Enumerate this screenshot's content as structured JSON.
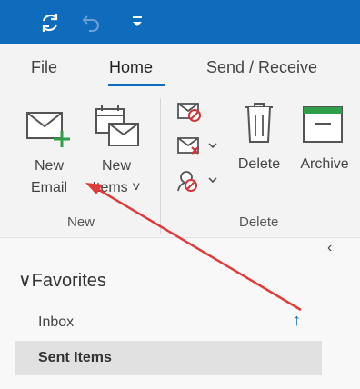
{
  "ribbon_tabs": {
    "file": "File",
    "home": "Home",
    "send_receive": "Send / Receive"
  },
  "new_group": {
    "new_email": {
      "line1": "New",
      "line2": "Email"
    },
    "new_items": {
      "line1": "New",
      "line2": "Items ˅"
    },
    "label": "New"
  },
  "delete_group": {
    "delete": "Delete",
    "archive": "Archive",
    "label": "Delete"
  },
  "nav": {
    "collapse_glyph": "‹",
    "favorites_header": "∨Favorites",
    "items": [
      {
        "label": "Inbox"
      },
      {
        "label": "Sent Items"
      }
    ],
    "inbox_indicator": "↑"
  },
  "colors": {
    "title_bar": "#0f6cbd",
    "ribbon_bg": "#f3f3f3",
    "annotation_arrow": "#e03a3a",
    "accent": "#0f6cbd"
  },
  "icons": {
    "sync": "sync-icon",
    "undo": "undo-icon",
    "customize_qat": "customize-qat-icon"
  }
}
